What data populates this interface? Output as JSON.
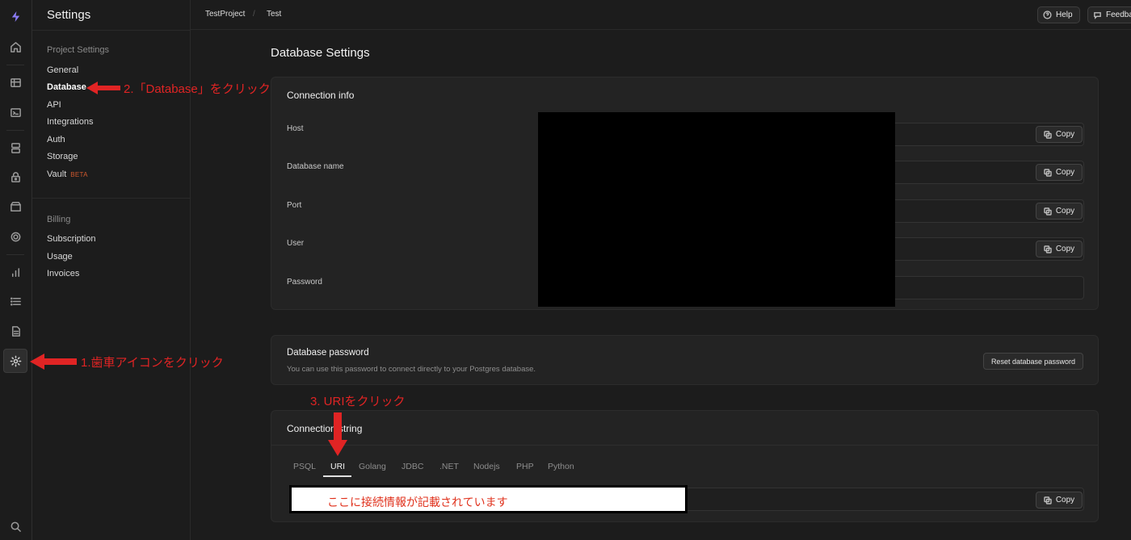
{
  "sidebar": {
    "title": "Settings",
    "project_group": "Project Settings",
    "project_items": [
      "General",
      "Database",
      "API",
      "Integrations",
      "Auth",
      "Storage",
      "Vault"
    ],
    "vault_badge": "BETA",
    "billing_group": "Billing",
    "billing_items": [
      "Subscription",
      "Usage",
      "Invoices"
    ]
  },
  "header": {
    "org": "TestProject",
    "project": "Test",
    "help_label": "Help",
    "feedback_label": "Feedback"
  },
  "page": {
    "title": "Database Settings"
  },
  "connection_info": {
    "title": "Connection info",
    "fields": [
      "Host",
      "Database name",
      "Port",
      "User",
      "Password"
    ],
    "copy_label": "Copy"
  },
  "db_password": {
    "title": "Database password",
    "description": "You can use this password to connect directly to your Postgres database.",
    "reset_label": "Reset database password"
  },
  "connection_string": {
    "title": "Connection string",
    "tabs": [
      "PSQL",
      "URI",
      "Golang",
      "JDBC",
      ".NET",
      "Nodejs",
      "PHP",
      "Python"
    ],
    "active_tab": "URI",
    "copy_label": "Copy"
  },
  "annotations": {
    "step1": "1.歯車アイコンをクリック",
    "step2": "2.「Database」をクリック",
    "step3": "3. URIをクリック",
    "uri_note": "ここに接続情報が記載されています"
  },
  "colors": {
    "accent": "#3ecf8e",
    "annotation": "#e02424",
    "beta": "#d1592e"
  }
}
